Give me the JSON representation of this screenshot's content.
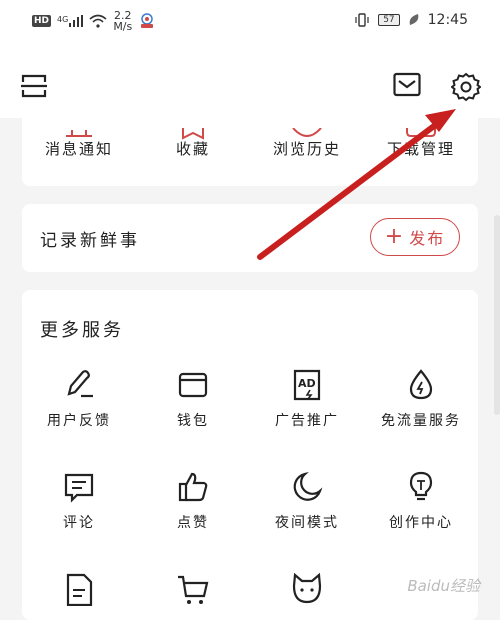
{
  "status_bar": {
    "hd_badge": "HD",
    "signal": "4G",
    "net_speed_value": "2.2",
    "net_speed_unit": "M/s",
    "battery": "57",
    "time": "12:45"
  },
  "header": {
    "scan_icon": "scan-icon",
    "mail_icon": "mail-icon",
    "settings_icon": "gear-icon"
  },
  "quick_links": [
    {
      "label": "消息通知",
      "icon": "bell-icon"
    },
    {
      "label": "收藏",
      "icon": "star-icon"
    },
    {
      "label": "浏览历史",
      "icon": "history-icon"
    },
    {
      "label": "下载管理",
      "icon": "download-icon"
    }
  ],
  "feed": {
    "title": "记录新鲜事",
    "publish_label": "发布",
    "publish_plus": "+"
  },
  "more_services": {
    "title": "更多服务",
    "items": [
      {
        "label": "用户反馈",
        "icon": "pen-icon"
      },
      {
        "label": "钱包",
        "icon": "wallet-icon"
      },
      {
        "label": "广告推广",
        "icon": "ad-icon"
      },
      {
        "label": "免流量服务",
        "icon": "drop-icon"
      },
      {
        "label": "评论",
        "icon": "comment-icon"
      },
      {
        "label": "点赞",
        "icon": "thumbs-up-icon"
      },
      {
        "label": "夜间模式",
        "icon": "moon-icon"
      },
      {
        "label": "创作中心",
        "icon": "bulb-icon"
      },
      {
        "label": "",
        "icon": "document-icon"
      },
      {
        "label": "",
        "icon": "cart-icon"
      },
      {
        "label": "",
        "icon": "cat-icon"
      }
    ]
  },
  "colors": {
    "accent": "#d14a4a",
    "arrow": "#c8201e"
  },
  "watermark": "Baidu经验"
}
